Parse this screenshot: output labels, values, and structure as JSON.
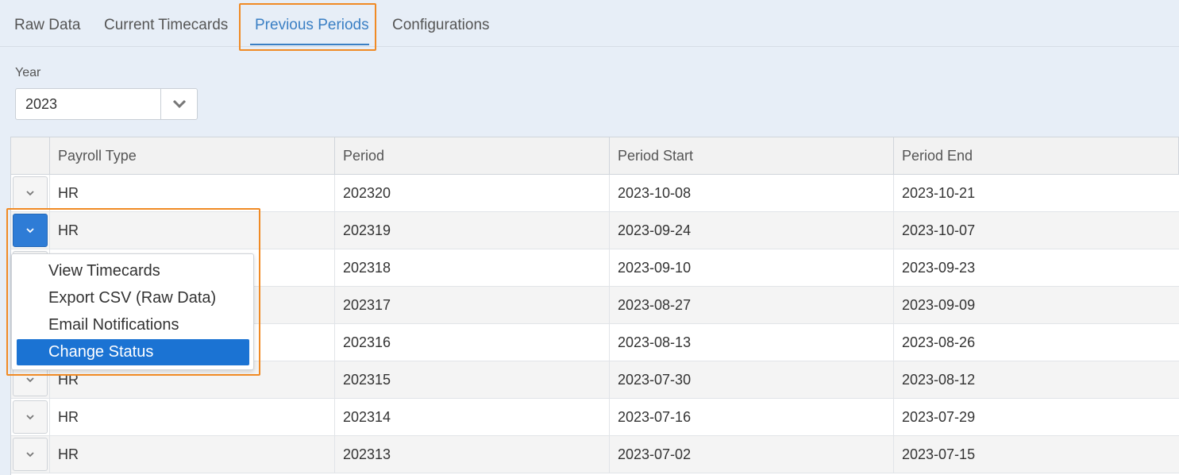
{
  "tabs": [
    {
      "label": "Raw Data"
    },
    {
      "label": "Current Timecards"
    },
    {
      "label": "Previous Periods"
    },
    {
      "label": "Configurations"
    }
  ],
  "active_tab": "Previous Periods",
  "year": {
    "label": "Year",
    "value": "2023"
  },
  "table": {
    "columns": [
      "Payroll Type",
      "Period",
      "Period Start",
      "Period End"
    ],
    "rows": [
      {
        "type": "HR",
        "period": "202320",
        "start": "2023-10-08",
        "end": "2023-10-21"
      },
      {
        "type": "HR",
        "period": "202319",
        "start": "2023-09-24",
        "end": "2023-10-07"
      },
      {
        "type": "",
        "period": "202318",
        "start": "2023-09-10",
        "end": "2023-09-23"
      },
      {
        "type": "",
        "period": "202317",
        "start": "2023-08-27",
        "end": "2023-09-09"
      },
      {
        "type": "",
        "period": "202316",
        "start": "2023-08-13",
        "end": "2023-08-26"
      },
      {
        "type": "HR",
        "period": "202315",
        "start": "2023-07-30",
        "end": "2023-08-12"
      },
      {
        "type": "HR",
        "period": "202314",
        "start": "2023-07-16",
        "end": "2023-07-29"
      },
      {
        "type": "HR",
        "period": "202313",
        "start": "2023-07-02",
        "end": "2023-07-15"
      }
    ]
  },
  "menu": {
    "items": [
      "View Timecards",
      "Export CSV (Raw Data)",
      "Email Notifications",
      "Change Status"
    ],
    "selected": "Change Status"
  },
  "colors": {
    "accent": "#3a7fc4",
    "highlight": "#f08a24",
    "menu_selected": "#1b73d3",
    "page_bg": "#e7eef7"
  },
  "icons": {
    "row_toggle": "chevron-down-icon",
    "year_toggle": "chevron-down-icon"
  }
}
